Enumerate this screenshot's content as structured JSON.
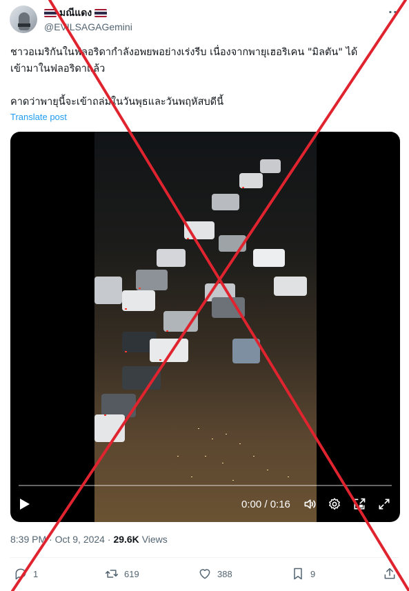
{
  "author": {
    "display_name": "มณีแดง",
    "handle": "@EVILSAGAGemini",
    "flag_colors": [
      "#A51931",
      "#F4F5F8",
      "#2D2A4A"
    ]
  },
  "tweet": {
    "text": "ชาวอเมริกันในฟลอริดากำลังอพยพอย่างเร่งรีบ เนื่องจากพายุเฮอริเคน \"มิลตัน\" ได้\nเข้ามาในฟลอริดาแล้ว\n\nคาดว่าพายุนี้จะเข้าถล่มในวันพุธและวันพฤหัสบดีนี้",
    "translate_label": "Translate post"
  },
  "video": {
    "time_display": "0:00 / 0:16",
    "progress": 0.0,
    "icons": [
      "play-icon",
      "volume-icon",
      "settings-icon",
      "pip-icon",
      "fullscreen-icon"
    ]
  },
  "meta": {
    "time": "8:39 PM",
    "separator": "·",
    "date": "Oct 9, 2024",
    "views_count": "29.6K",
    "views_label": "Views"
  },
  "actions": {
    "replies": "1",
    "reposts": "619",
    "likes": "388",
    "bookmarks": "9"
  },
  "overlay": {
    "type": "red-x-mark",
    "color": "#e0242f"
  },
  "colors": {
    "link": "#1d9bf0",
    "secondary_text": "#536471",
    "primary_text": "#0f1419"
  }
}
